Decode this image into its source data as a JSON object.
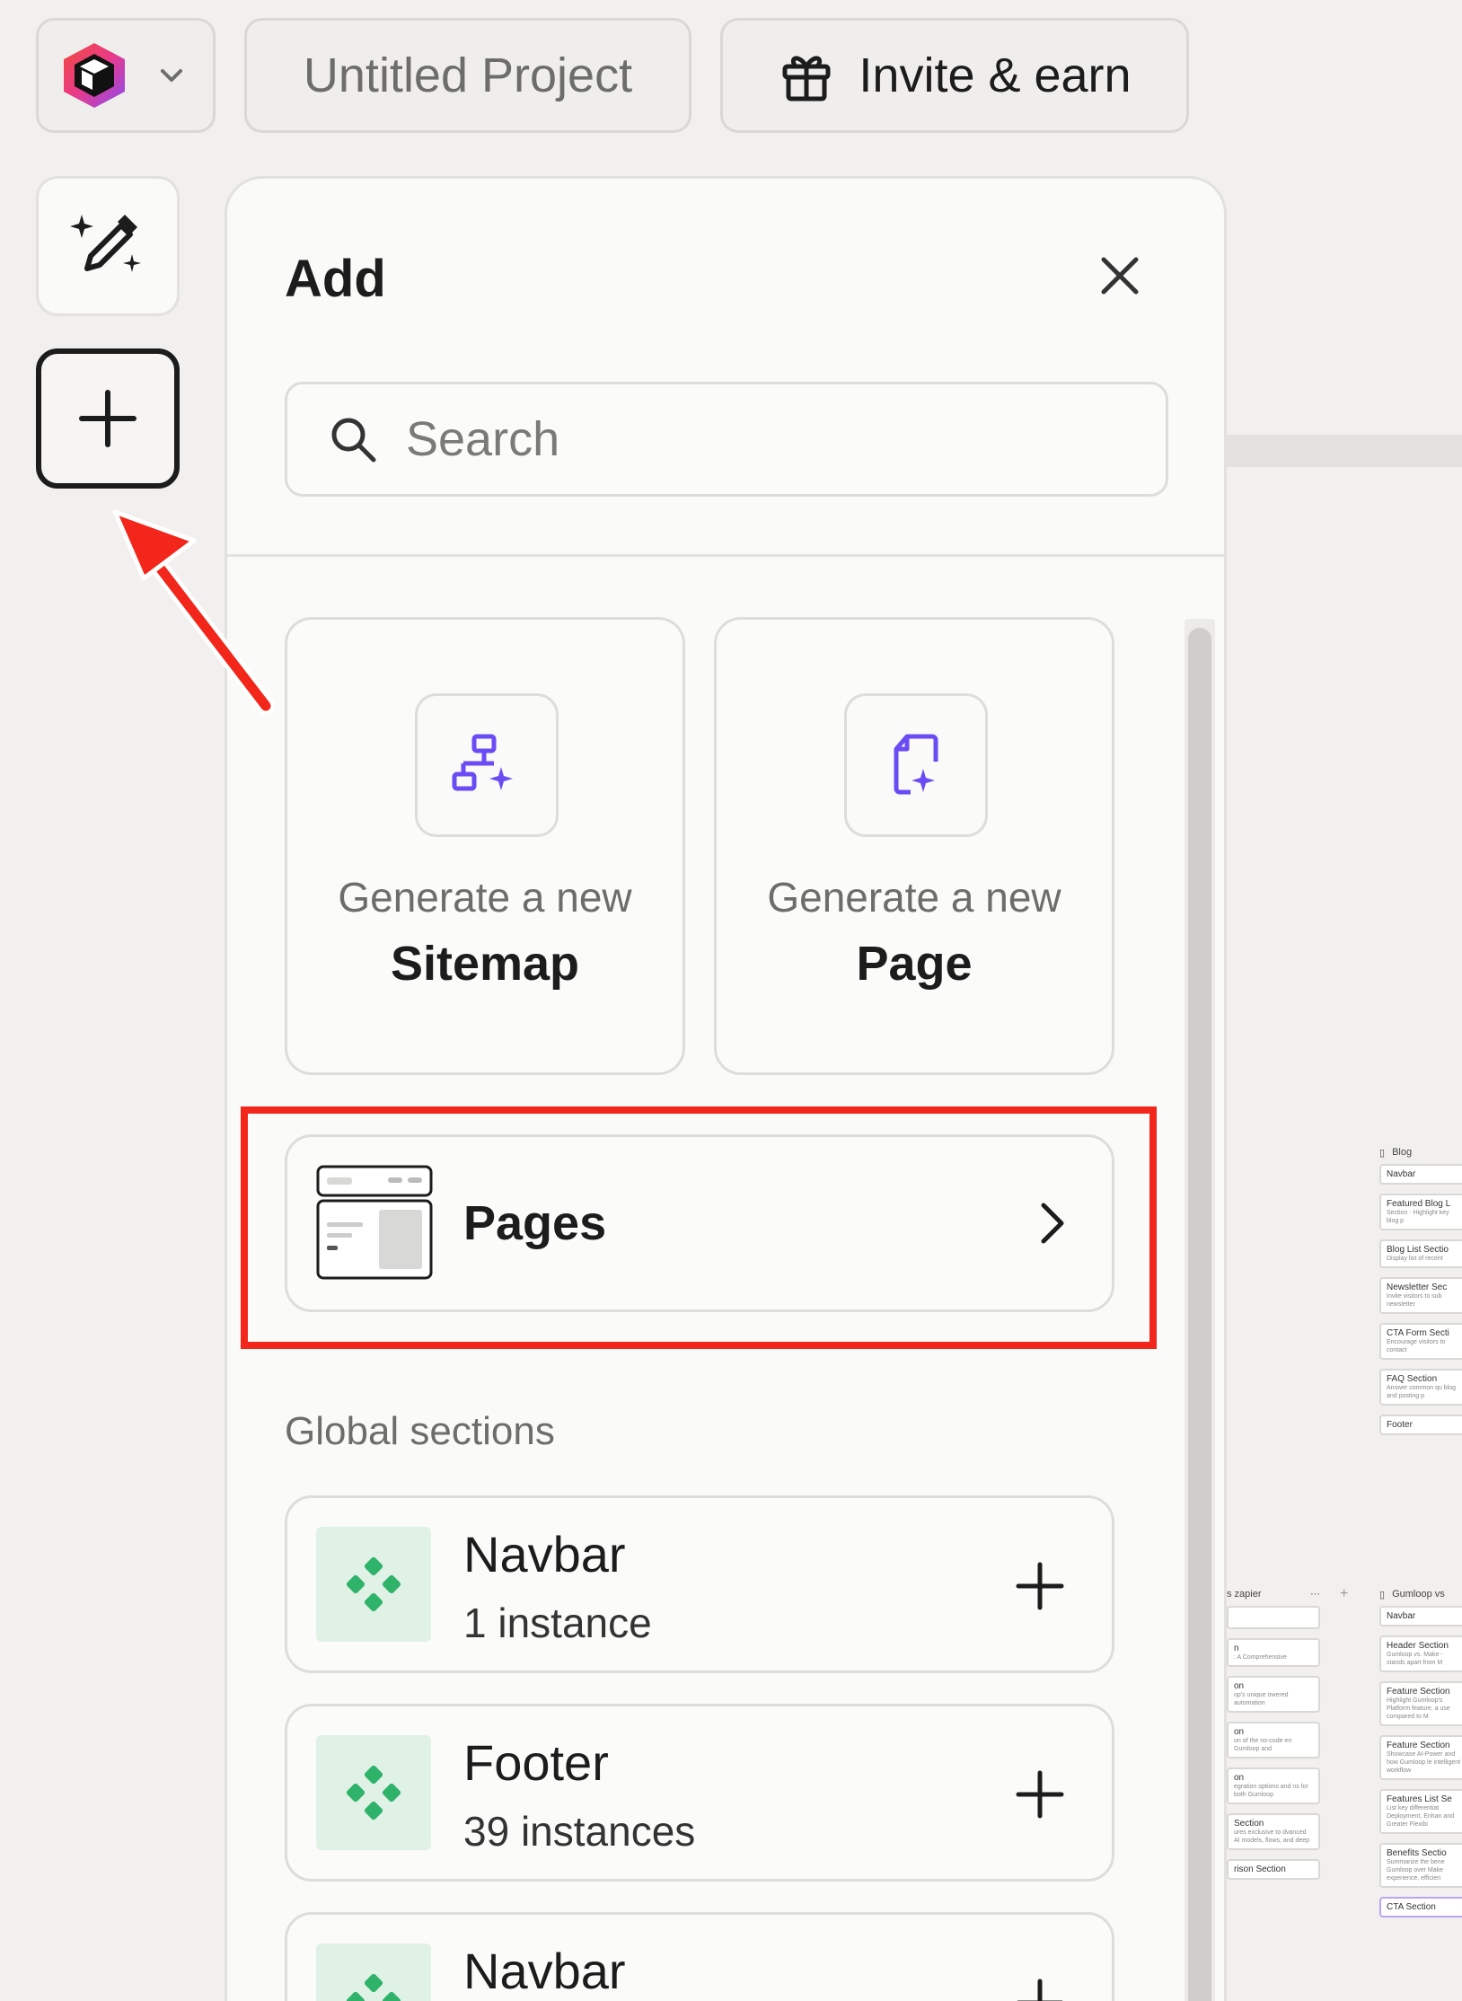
{
  "topbar": {
    "project_name": "Untitled Project",
    "invite_label": "Invite & earn"
  },
  "panel": {
    "title": "Add",
    "search_placeholder": "Search",
    "generate_cards": [
      {
        "subtitle": "Generate a new",
        "title": "Sitemap",
        "icon": "sitemap-sparkle-icon"
      },
      {
        "subtitle": "Generate a new",
        "title": "Page",
        "icon": "page-sparkle-icon"
      }
    ],
    "pages_label": "Pages",
    "global_sections_heading": "Global sections",
    "global_sections": [
      {
        "name": "Navbar",
        "count": "1 instance"
      },
      {
        "name": "Footer",
        "count": "39 instances"
      },
      {
        "name": "Navbar",
        "count": ""
      }
    ]
  },
  "canvas": {
    "blog_column": {
      "title": "Blog",
      "cards": [
        {
          "title": "Navbar",
          "sub": ""
        },
        {
          "title": "Featured Blog L",
          "sub": "Section · Highlight key blog p"
        },
        {
          "title": "Blog List Sectio",
          "sub": "Display list of recent"
        },
        {
          "title": "Newsletter Sec",
          "sub": "Invite visitors to sub newsletter"
        },
        {
          "title": "CTA Form Secti",
          "sub": "Encourage visitors to contact"
        },
        {
          "title": "FAQ Section",
          "sub": "Answer common qu blog and posting p"
        },
        {
          "title": "Footer",
          "sub": ""
        }
      ]
    },
    "zapier_column": {
      "title": "s zapier",
      "cards": [
        {
          "title": "",
          "sub": ""
        },
        {
          "title": "n",
          "sub": ": A Comprehensive"
        },
        {
          "title": "on",
          "sub": "op's unique owered automation"
        },
        {
          "title": "on",
          "sub": "on of the no-code en Gumloop and"
        },
        {
          "title": "on",
          "sub": "egration options and ns for both Gumloop"
        },
        {
          "title": "Section",
          "sub": "ures exclusive to dvanced AI models, flows, and deep"
        },
        {
          "title": "rison Section",
          "sub": ""
        }
      ]
    },
    "gumloop_column": {
      "title": "Gumloop vs",
      "cards": [
        {
          "title": "Navbar",
          "sub": ""
        },
        {
          "title": "Header Section",
          "sub": "Gumloop vs. Make - stands apart from M"
        },
        {
          "title": "Feature Section",
          "sub": "Highlight Gumloop's Platform feature, a use compared to M"
        },
        {
          "title": "Feature Section",
          "sub": "Showcase AI-Power and how Gumloop le intelligent workflow"
        },
        {
          "title": "Features List Se",
          "sub": "List key differentiat Deployment, Enhan and Greater Flexibi"
        },
        {
          "title": "Benefits Sectio",
          "sub": "Summarize the bene Gumloop over Make experience, efficien"
        },
        {
          "title": "CTA Section",
          "sub": ""
        }
      ]
    }
  },
  "colors": {
    "accent_purple": "#6a4cf5",
    "global_green": "#2fb36a",
    "annotation_red": "#f2261a"
  }
}
